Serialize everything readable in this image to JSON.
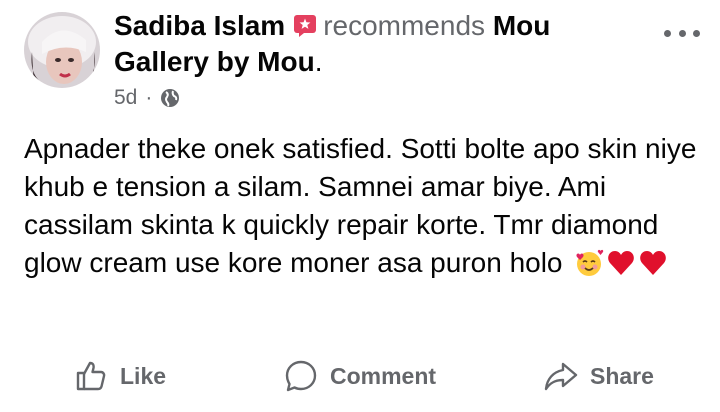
{
  "post": {
    "author": "Sadiba Islam",
    "verb": "recommends",
    "page_name": "Mou Gallery by Mou",
    "page_suffix": ".",
    "time": "5d",
    "separator": "·",
    "audience_icon": "globe-icon",
    "body": "Apnader theke onek satisfied. Sotti bolte apo skin niye khub e tension a silam. Samnei amar biye. Ami cassilam skinta k quickly repair korte. Tmr diamond glow cream use kore moner asa puron holo",
    "emojis": [
      "smiling-face-with-hearts",
      "red-heart",
      "red-heart"
    ]
  },
  "actions": {
    "like_label": "Like",
    "comment_label": "Comment",
    "share_label": "Share"
  },
  "colors": {
    "secondary_text": "#65676b",
    "primary_text": "#050505",
    "recommend_badge": "#e4405f"
  }
}
